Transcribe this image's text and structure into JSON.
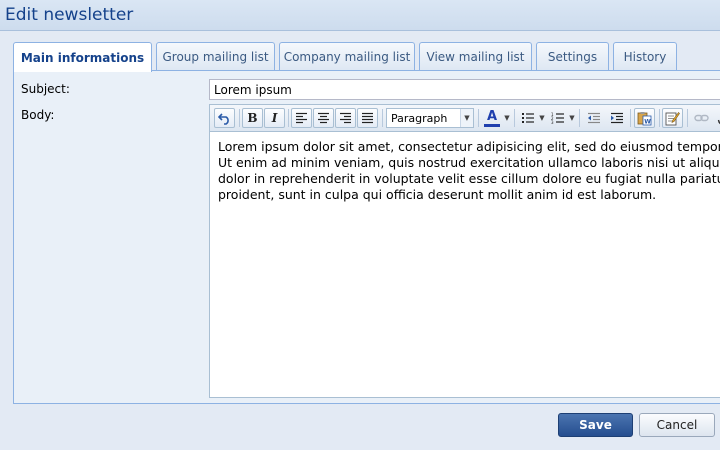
{
  "window": {
    "title": "Edit newsletter"
  },
  "tabs": [
    {
      "label": "Main informations",
      "active": true
    },
    {
      "label": "Group mailing list",
      "active": false
    },
    {
      "label": "Company mailing list",
      "active": false
    },
    {
      "label": "View mailing list",
      "active": false
    },
    {
      "label": "Settings",
      "active": false
    },
    {
      "label": "History",
      "active": false
    }
  ],
  "form": {
    "subject_label": "Subject:",
    "subject_value": "Lorem ipsum",
    "body_label": "Body:"
  },
  "toolbar": {
    "undo_icon": "undo-icon",
    "bold_glyph": "B",
    "italic_glyph": "I",
    "format_select_value": "Paragraph",
    "font_color_glyph": "A",
    "font_color_bar": "#1f3fae"
  },
  "editor": {
    "lines": [
      "Lorem ipsum dolor sit amet, consectetur adipisicing elit, sed do eiusmod tempor",
      "Ut enim ad minim veniam, quis nostrud exercitation ullamco laboris nisi ut aliquip",
      "dolor in reprehenderit in voluptate velit esse cillum dolore eu fugiat nulla pariatur",
      "proident, sunt in culpa qui officia deserunt mollit anim id est laborum."
    ]
  },
  "footer": {
    "save_label": "Save",
    "cancel_label": "Cancel"
  },
  "colors": {
    "title_text": "#15428b",
    "save_button": "#2c5696",
    "panel_border": "#8db2e3"
  }
}
